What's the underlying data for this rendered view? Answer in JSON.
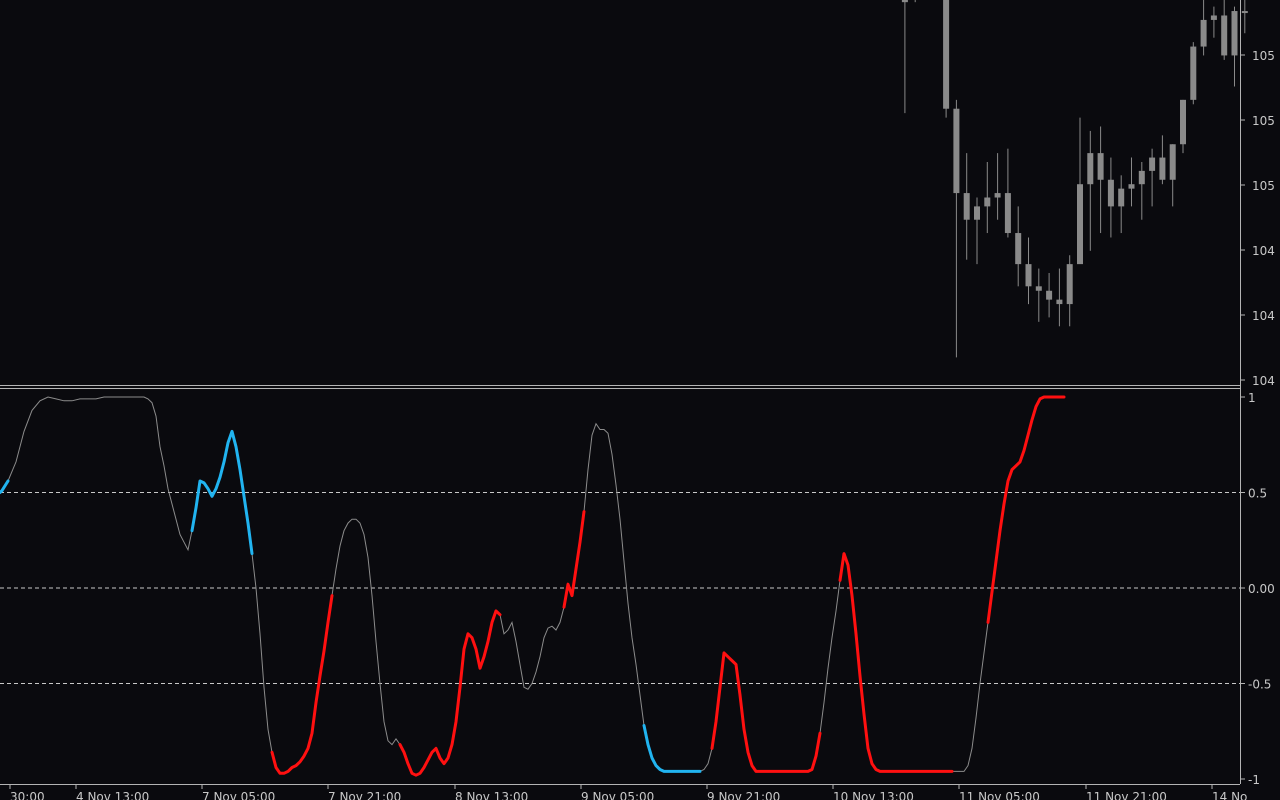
{
  "app": {
    "theme": "dark"
  },
  "colors": {
    "background": "#0a0a0e",
    "candle": "#8a8a8a",
    "separator": "#b4b4b4",
    "level_line": "#c8c8c8",
    "neutral_line": "#8c8c8c",
    "bull_line": "#21b4f0",
    "bear_line": "#ff1010",
    "axis_text": "#c8c8c8"
  },
  "price_panel": {
    "axis_labels": [
      "105",
      "105",
      "105",
      "104",
      "104",
      "104"
    ]
  },
  "indicator_panel": {
    "axis_labels": [
      "1",
      "0.5",
      "0.00",
      "-0.5",
      "-1"
    ]
  },
  "time_axis": {
    "labels": [
      "30:00",
      "4 Nov 13:00",
      "7 Nov 05:00",
      "7 Nov 21:00",
      "8 Nov 13:00",
      "9 Nov 05:00",
      "9 Nov 21:00",
      "10 Nov 13:00",
      "11 Nov 05:00",
      "11 Nov 21:00",
      "14 No"
    ]
  },
  "chart_data": [
    {
      "type": "candlestick",
      "title": "",
      "note": "Price pane, left part empty (history scrolled). Values in relative price units 0-1 (bottom to top of pane).",
      "candles": [
        {
          "o": 1.02,
          "h": 1.05,
          "l": 0.99,
          "c": 1.0
        },
        {
          "o": 1.02,
          "h": 1.05,
          "l": 0.99,
          "c": 1.03
        },
        {
          "o": 1.0,
          "h": 1.03,
          "l": 0.88,
          "c": 0.94
        },
        {
          "o": 0.99,
          "h": 1.04,
          "l": 0.61,
          "c": 0.86
        },
        {
          "o": 1.02,
          "h": 1.05,
          "l": 0.86,
          "c": 0.87
        },
        {
          "o": 1.03,
          "h": 1.05,
          "l": 0.97,
          "c": 1.02
        },
        {
          "o": 0.99,
          "h": 1.05,
          "l": 0.87,
          "c": 0.89
        },
        {
          "o": 0.89,
          "h": 0.92,
          "l": 0.6,
          "c": 0.62
        },
        {
          "o": 0.62,
          "h": 0.64,
          "l": 0.06,
          "c": 0.43
        },
        {
          "o": 0.43,
          "h": 0.52,
          "l": 0.28,
          "c": 0.37
        },
        {
          "o": 0.37,
          "h": 0.42,
          "l": 0.27,
          "c": 0.4
        },
        {
          "o": 0.4,
          "h": 0.5,
          "l": 0.34,
          "c": 0.42
        },
        {
          "o": 0.42,
          "h": 0.52,
          "l": 0.37,
          "c": 0.43
        },
        {
          "o": 0.43,
          "h": 0.53,
          "l": 0.33,
          "c": 0.34
        },
        {
          "o": 0.34,
          "h": 0.4,
          "l": 0.22,
          "c": 0.27
        },
        {
          "o": 0.27,
          "h": 0.33,
          "l": 0.18,
          "c": 0.22
        },
        {
          "o": 0.22,
          "h": 0.26,
          "l": 0.14,
          "c": 0.21
        },
        {
          "o": 0.21,
          "h": 0.25,
          "l": 0.15,
          "c": 0.19
        },
        {
          "o": 0.19,
          "h": 0.26,
          "l": 0.13,
          "c": 0.18
        },
        {
          "o": 0.18,
          "h": 0.29,
          "l": 0.13,
          "c": 0.27
        },
        {
          "o": 0.27,
          "h": 0.6,
          "l": 0.31,
          "c": 0.45
        },
        {
          "o": 0.45,
          "h": 0.57,
          "l": 0.3,
          "c": 0.52
        },
        {
          "o": 0.52,
          "h": 0.58,
          "l": 0.34,
          "c": 0.46
        },
        {
          "o": 0.46,
          "h": 0.51,
          "l": 0.33,
          "c": 0.4
        },
        {
          "o": 0.4,
          "h": 0.47,
          "l": 0.34,
          "c": 0.44
        },
        {
          "o": 0.44,
          "h": 0.51,
          "l": 0.4,
          "c": 0.45
        },
        {
          "o": 0.45,
          "h": 0.5,
          "l": 0.37,
          "c": 0.48
        },
        {
          "o": 0.48,
          "h": 0.53,
          "l": 0.4,
          "c": 0.51
        },
        {
          "o": 0.51,
          "h": 0.56,
          "l": 0.45,
          "c": 0.46
        },
        {
          "o": 0.46,
          "h": 0.54,
          "l": 0.4,
          "c": 0.54
        },
        {
          "o": 0.54,
          "h": 0.64,
          "l": 0.52,
          "c": 0.64
        },
        {
          "o": 0.64,
          "h": 0.77,
          "l": 0.63,
          "c": 0.76
        },
        {
          "o": 0.76,
          "h": 0.87,
          "l": 0.74,
          "c": 0.82
        },
        {
          "o": 0.82,
          "h": 0.85,
          "l": 0.78,
          "c": 0.83
        },
        {
          "o": 0.83,
          "h": 0.87,
          "l": 0.73,
          "c": 0.74
        },
        {
          "o": 0.74,
          "h": 0.85,
          "l": 0.67,
          "c": 0.84
        },
        {
          "o": 0.84,
          "h": 0.89,
          "l": 0.79,
          "c": 0.84
        }
      ]
    },
    {
      "type": "line",
      "title": "",
      "note": "Oscillator pane; bull (blue) where value > 0.5 region rising, bear (red) where value < -0.5 region falling.",
      "ylim": [
        -1,
        1
      ],
      "levels": [
        0.5,
        0.0,
        -0.5
      ],
      "x": [
        0,
        2,
        8,
        16,
        24,
        32,
        40,
        48,
        56,
        64,
        72,
        80,
        88,
        96,
        104,
        112,
        120,
        128,
        136,
        140,
        144,
        148,
        152,
        156,
        158,
        160,
        164,
        168,
        172,
        176,
        180,
        184,
        188,
        192,
        196,
        200,
        204,
        208,
        212,
        216,
        220,
        224,
        228,
        232,
        236,
        240,
        244,
        248,
        252,
        256,
        260,
        264,
        268,
        272,
        276,
        280,
        284,
        288,
        292,
        296,
        300,
        304,
        308,
        312,
        316,
        320,
        324,
        328,
        332,
        336,
        340,
        344,
        348,
        352,
        356,
        360,
        364,
        368,
        372,
        376,
        380,
        384,
        388,
        392,
        396,
        400,
        404,
        408,
        412,
        416,
        420,
        424,
        428,
        432,
        436,
        440,
        444,
        448,
        452,
        456,
        460,
        464,
        468,
        472,
        476,
        480,
        484,
        488,
        492,
        496,
        500,
        504,
        508,
        512,
        516,
        520,
        524,
        528,
        532,
        536,
        540,
        544,
        548,
        552,
        556,
        560,
        564,
        568,
        572,
        576,
        580,
        584,
        588,
        592,
        596,
        600,
        604,
        608,
        612,
        616,
        620,
        624,
        628,
        632,
        636,
        640,
        644,
        648,
        652,
        656,
        660,
        664,
        668,
        672,
        676,
        680,
        684,
        688,
        692,
        696,
        700,
        704,
        708,
        712,
        716,
        720,
        724,
        728,
        732,
        736,
        740,
        744,
        748,
        752,
        756,
        760,
        764,
        768,
        772,
        776,
        780,
        784,
        788,
        792,
        796,
        800,
        804,
        808,
        812,
        816,
        820,
        824,
        828,
        832,
        836,
        840,
        844,
        848,
        852,
        856,
        860,
        864,
        868,
        872,
        876,
        880,
        884,
        888,
        892,
        896,
        900,
        904,
        908,
        912,
        916,
        920,
        924,
        928,
        932,
        936,
        940,
        944,
        948,
        952,
        956,
        960,
        964,
        968,
        972,
        976,
        980,
        984,
        988,
        992,
        996,
        1000,
        1004,
        1008,
        1012,
        1016,
        1020,
        1024,
        1028,
        1032,
        1036,
        1040,
        1044,
        1048,
        1052,
        1056,
        1060,
        1064,
        1068,
        1072,
        1076,
        1080,
        1084,
        1088,
        1092,
        1096,
        1100,
        1104,
        1108,
        1112,
        1116,
        1120,
        1124,
        1128,
        1132,
        1136,
        1140,
        1144,
        1148,
        1152,
        1156,
        1160,
        1164,
        1168,
        1172,
        1176,
        1180,
        1184,
        1188,
        1192,
        1196,
        1200,
        1204,
        1208,
        1212,
        1216,
        1220,
        1224,
        1228,
        1232,
        1236
      ],
      "y": [
        0.5,
        0.51,
        0.56,
        0.66,
        0.82,
        0.93,
        0.98,
        1.0,
        0.99,
        0.98,
        0.98,
        0.99,
        0.99,
        0.99,
        1.0,
        1.0,
        1.0,
        1.0,
        1.0,
        1.0,
        1.0,
        0.99,
        0.97,
        0.9,
        0.82,
        0.74,
        0.64,
        0.52,
        0.44,
        0.36,
        0.28,
        0.24,
        0.2,
        0.3,
        0.42,
        0.56,
        0.55,
        0.52,
        0.48,
        0.52,
        0.58,
        0.66,
        0.76,
        0.82,
        0.74,
        0.62,
        0.48,
        0.34,
        0.18,
        0.0,
        -0.24,
        -0.52,
        -0.74,
        -0.86,
        -0.94,
        -0.97,
        -0.97,
        -0.96,
        -0.94,
        -0.93,
        -0.91,
        -0.88,
        -0.84,
        -0.76,
        -0.6,
        -0.46,
        -0.33,
        -0.18,
        -0.04,
        0.1,
        0.22,
        0.3,
        0.34,
        0.36,
        0.36,
        0.34,
        0.28,
        0.16,
        -0.04,
        -0.28,
        -0.5,
        -0.7,
        -0.8,
        -0.82,
        -0.79,
        -0.82,
        -0.86,
        -0.92,
        -0.97,
        -0.98,
        -0.97,
        -0.94,
        -0.9,
        -0.86,
        -0.84,
        -0.89,
        -0.92,
        -0.89,
        -0.82,
        -0.7,
        -0.52,
        -0.32,
        -0.24,
        -0.26,
        -0.32,
        -0.42,
        -0.36,
        -0.28,
        -0.18,
        -0.12,
        -0.14,
        -0.24,
        -0.22,
        -0.18,
        -0.28,
        -0.4,
        -0.52,
        -0.53,
        -0.5,
        -0.44,
        -0.36,
        -0.26,
        -0.21,
        -0.2,
        -0.22,
        -0.18,
        -0.1,
        0.02,
        -0.04,
        0.1,
        0.24,
        0.4,
        0.62,
        0.8,
        0.86,
        0.83,
        0.83,
        0.81,
        0.7,
        0.54,
        0.36,
        0.14,
        -0.08,
        -0.26,
        -0.4,
        -0.56,
        -0.72,
        -0.82,
        -0.89,
        -0.93,
        -0.95,
        -0.96,
        -0.96,
        -0.96,
        -0.96,
        -0.96,
        -0.96,
        -0.96,
        -0.96,
        -0.96,
        -0.96,
        -0.95,
        -0.92,
        -0.84,
        -0.7,
        -0.52,
        -0.34,
        -0.36,
        -0.38,
        -0.4,
        -0.56,
        -0.74,
        -0.86,
        -0.93,
        -0.96,
        -0.96,
        -0.96,
        -0.96,
        -0.96,
        -0.96,
        -0.96,
        -0.96,
        -0.96,
        -0.96,
        -0.96,
        -0.96,
        -0.96,
        -0.96,
        -0.95,
        -0.88,
        -0.76,
        -0.6,
        -0.42,
        -0.26,
        -0.12,
        0.04,
        0.18,
        0.12,
        -0.04,
        -0.24,
        -0.46,
        -0.66,
        -0.84,
        -0.92,
        -0.95,
        -0.96,
        -0.96,
        -0.96,
        -0.96,
        -0.96,
        -0.96,
        -0.96,
        -0.96,
        -0.96,
        -0.96,
        -0.96,
        -0.96,
        -0.96,
        -0.96,
        -0.96,
        -0.96,
        -0.96,
        -0.96,
        -0.96,
        -0.96,
        -0.96,
        -0.96,
        -0.93,
        -0.84,
        -0.68,
        -0.5,
        -0.34,
        -0.18,
        -0.02,
        0.14,
        0.3,
        0.44,
        0.56,
        0.62,
        0.64,
        0.66,
        0.72,
        0.8,
        0.88,
        0.95,
        0.99,
        1.0,
        1.0,
        1.0,
        1.0,
        1.0,
        1.0
      ],
      "series": [
        {
          "name": "",
          "color_key": "bull_line",
          "ranges": [
            [
              0,
              8
            ],
            [
              192,
              252
            ],
            [
              644,
              700
            ],
            [
              1156,
              1236
            ]
          ]
        },
        {
          "name": "",
          "color_key": "bear_line",
          "ranges": [
            [
              272,
              332
            ],
            [
              400,
              500
            ],
            [
              564,
              584
            ],
            [
              712,
              820
            ],
            [
              840,
              952
            ],
            [
              988,
              1112
            ]
          ]
        }
      ]
    }
  ]
}
